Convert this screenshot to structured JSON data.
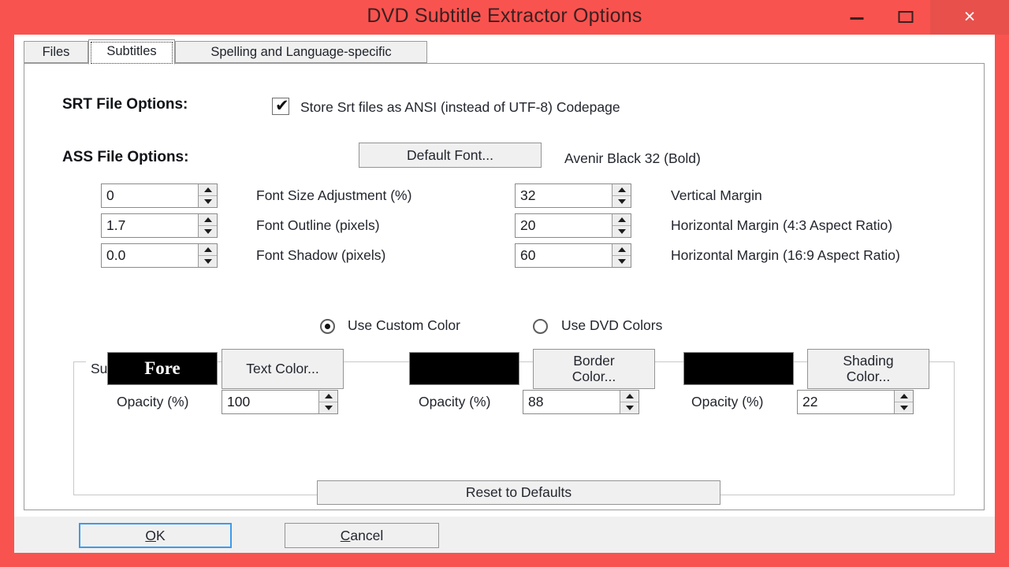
{
  "window": {
    "title": "DVD Subtitle Extractor Options",
    "accent_red": "#F9534F",
    "close_hover": "#E8504C",
    "minimize_label": "Minimize",
    "maximize_label": "Maximize",
    "close_glyph": "×"
  },
  "tabs": [
    {
      "label": "Files",
      "selected": false
    },
    {
      "label": "Subtitles",
      "selected": true
    },
    {
      "label": "Spelling and Language-specific",
      "selected": false
    }
  ],
  "srt": {
    "section_label": "SRT File Options:",
    "ansi_checkbox_label": "Store Srt files as ANSI (instead of UTF-8) Codepage",
    "ansi_checked": true,
    "tick_glyph": "✔"
  },
  "ass": {
    "section_label": "ASS File Options:",
    "default_font_button": "Default Font...",
    "font_description": "Avenir Black 32 (Bold)"
  },
  "numeric_left": [
    {
      "value": "0",
      "label": "Font Size Adjustment (%)"
    },
    {
      "value": "1.7",
      "label": "Font Outline (pixels)"
    },
    {
      "value": "0.0",
      "label": "Font Shadow (pixels)"
    }
  ],
  "numeric_right": [
    {
      "value": "32",
      "label": "Vertical Margin"
    },
    {
      "value": "20",
      "label": "Horizontal Margin (4:3 Aspect Ratio)"
    },
    {
      "value": "60",
      "label": "Horizontal Margin (16:9 Aspect Ratio)"
    }
  ],
  "subtitle_colors": {
    "group_title": "Subtitle Colors",
    "radio_custom_label": "Use Custom Color",
    "radio_dvd_label": "Use DVD Colors",
    "selected_mode": "Use Custom Color",
    "fore_swatch_text": "Fore",
    "fore_swatch_color": "#000000",
    "fore_text_color": "#ffffff",
    "text_color_button": "Text Color...",
    "border_swatch_color": "#000000",
    "border_color_button": "Border\nColor...",
    "shading_swatch_color": "#000000",
    "shading_color_button": "Shading\nColor...",
    "opacity_label": "Opacity (%)",
    "opacity_text": "100",
    "opacity_border": "88",
    "opacity_shading": "22"
  },
  "actions": {
    "reset_button": "Reset to Defaults",
    "ok_accel": "O",
    "ok_rest": "K",
    "cancel_accel": "C",
    "cancel_rest": "ancel"
  }
}
